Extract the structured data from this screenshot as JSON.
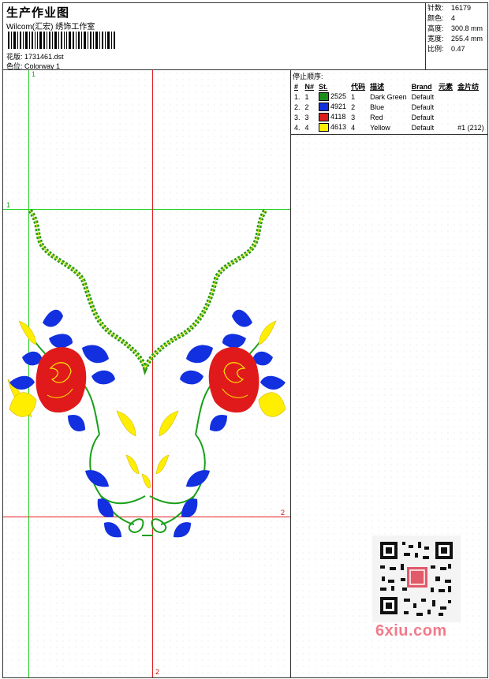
{
  "header": {
    "title": "生产作业图",
    "studio": "Wilcom(汇宏) 绣饰工作室",
    "design_label": "花版:",
    "design_file": "1731461.dst",
    "colorway_label": "色位:",
    "colorway": "Colorway 1"
  },
  "stats": [
    {
      "label": "针数:",
      "value": "16179"
    },
    {
      "label": "颜色:",
      "value": "4"
    },
    {
      "label": "高度:",
      "value": "300.8 mm"
    },
    {
      "label": "宽度:",
      "value": "255.4 mm"
    },
    {
      "label": "比例:",
      "value": "0.47"
    }
  ],
  "stop_sequence": {
    "title": "停止顺序:",
    "headers": [
      "#",
      "N#",
      "St.",
      "代码",
      "描述",
      "Brand",
      "元素",
      "金片纺"
    ],
    "rows": [
      {
        "idx": "1.",
        "n": "1",
        "st": "2525",
        "code": "1",
        "desc": "Dark Green",
        "brand": "Default",
        "element": "",
        "sequin": "",
        "color": "#1a8f1a"
      },
      {
        "idx": "2.",
        "n": "2",
        "st": "4921",
        "code": "2",
        "desc": "Blue",
        "brand": "Default",
        "element": "",
        "sequin": "",
        "color": "#1230e0"
      },
      {
        "idx": "3.",
        "n": "3",
        "st": "4118",
        "code": "3",
        "desc": "Red",
        "brand": "Default",
        "element": "",
        "sequin": "",
        "color": "#e01a1a"
      },
      {
        "idx": "4.",
        "n": "4",
        "st": "4613",
        "code": "4",
        "desc": "Yellow",
        "brand": "Default",
        "element": "",
        "sequin": "#1 (212)",
        "color": "#ffee00"
      }
    ]
  },
  "guides": {
    "green_v": "1",
    "green_h": "1",
    "red_h": "2",
    "red_v": "2"
  },
  "watermark": "6xiu.com"
}
